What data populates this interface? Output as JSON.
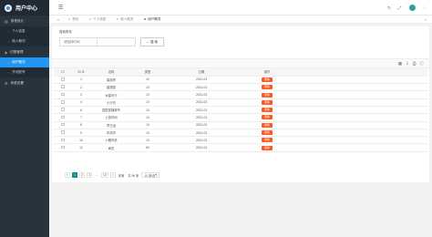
{
  "app": {
    "title": "用户中心"
  },
  "sidebar": {
    "groups": [
      {
        "label": "报表统计",
        "items": [
          {
            "label": "个人信息"
          },
          {
            "label": "新人概况"
          }
        ]
      },
      {
        "label": "仿冒管理",
        "items": [
          {
            "label": "用户概况",
            "active": true
          },
          {
            "label": "开设账号"
          }
        ]
      },
      {
        "label": "收费设置",
        "items": []
      }
    ]
  },
  "tabs": [
    {
      "label": "首页"
    },
    {
      "label": "个人信息"
    },
    {
      "label": "新人概况"
    },
    {
      "label": "用户概况",
      "active": true
    }
  ],
  "search": {
    "title": "搜索条件",
    "placeholder": "请选择时间",
    "button": "搜 索"
  },
  "table": {
    "headers": [
      "ID",
      "名称",
      "类型",
      "日期",
      "操作"
    ],
    "delete_label": "删除",
    "rows": [
      {
        "id": "1",
        "name": "康部育",
        "type": "10",
        "date": "2021-03"
      },
      {
        "id": "2",
        "name": "建理部",
        "type": "10",
        "date": "2021-03"
      },
      {
        "id": "3",
        "name": "木婚写厅",
        "type": "10",
        "date": "2021-03"
      },
      {
        "id": "4",
        "name": "小厅内",
        "type": "10",
        "date": "2021-03"
      },
      {
        "id": "6",
        "name": "园居奖随新所",
        "type": "10",
        "date": "2021-03"
      },
      {
        "id": "7",
        "name": "土营内间",
        "type": "10",
        "date": "2021-03"
      },
      {
        "id": "8",
        "name": "界它运",
        "type": "10",
        "date": "2021-03"
      },
      {
        "id": "9",
        "name": "车成内",
        "type": "10",
        "date": "2021-03"
      },
      {
        "id": "10",
        "name": "小雁内说",
        "type": "10",
        "date": "2021-03"
      },
      {
        "id": "12",
        "name": "两员",
        "type": "60",
        "date": "2021-04"
      }
    ]
  },
  "pager": {
    "pages": [
      "1",
      "2",
      "3",
      "...",
      "10",
      ">"
    ],
    "current": "1",
    "goto_label": "到第",
    "total": "共 96 条",
    "per_page": "10 条/页"
  },
  "colors": {
    "accent": "#2196f3",
    "danger": "#ff5722",
    "pager": "#009688",
    "sidebar": "#28333e"
  }
}
